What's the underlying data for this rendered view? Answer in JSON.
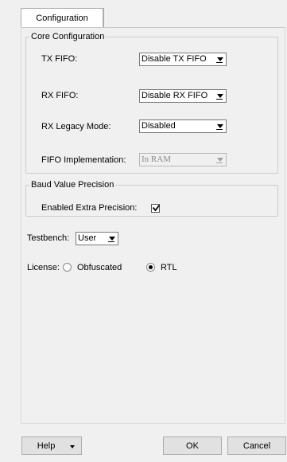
{
  "tabs": [
    {
      "label": "Configuration",
      "active": true
    }
  ],
  "core_group": {
    "legend": "Core Configuration",
    "tx_fifo_label": "TX FIFO:",
    "tx_fifo_value": "Disable TX FIFO",
    "rx_fifo_label": "RX FIFO:",
    "rx_fifo_value": "Disable RX FIFO",
    "rx_legacy_label": "RX Legacy Mode:",
    "rx_legacy_value": "Disabled",
    "fifo_impl_label": "FIFO Implementation:",
    "fifo_impl_value": "In RAM"
  },
  "baud_group": {
    "legend": "Baud Value Precision",
    "extra_precision_label": "Enabled Extra Precision:",
    "extra_precision_checked": true
  },
  "testbench": {
    "label": "Testbench:",
    "value": "User"
  },
  "license": {
    "label": "License:",
    "options": [
      {
        "label": "Obfuscated",
        "selected": false
      },
      {
        "label": "RTL",
        "selected": true
      }
    ]
  },
  "footer": {
    "help_label": "Help",
    "ok_label": "OK",
    "cancel_label": "Cancel"
  },
  "icons": [
    "dropdown-arrow-icon",
    "checkmark-icon",
    "radio-icon"
  ]
}
